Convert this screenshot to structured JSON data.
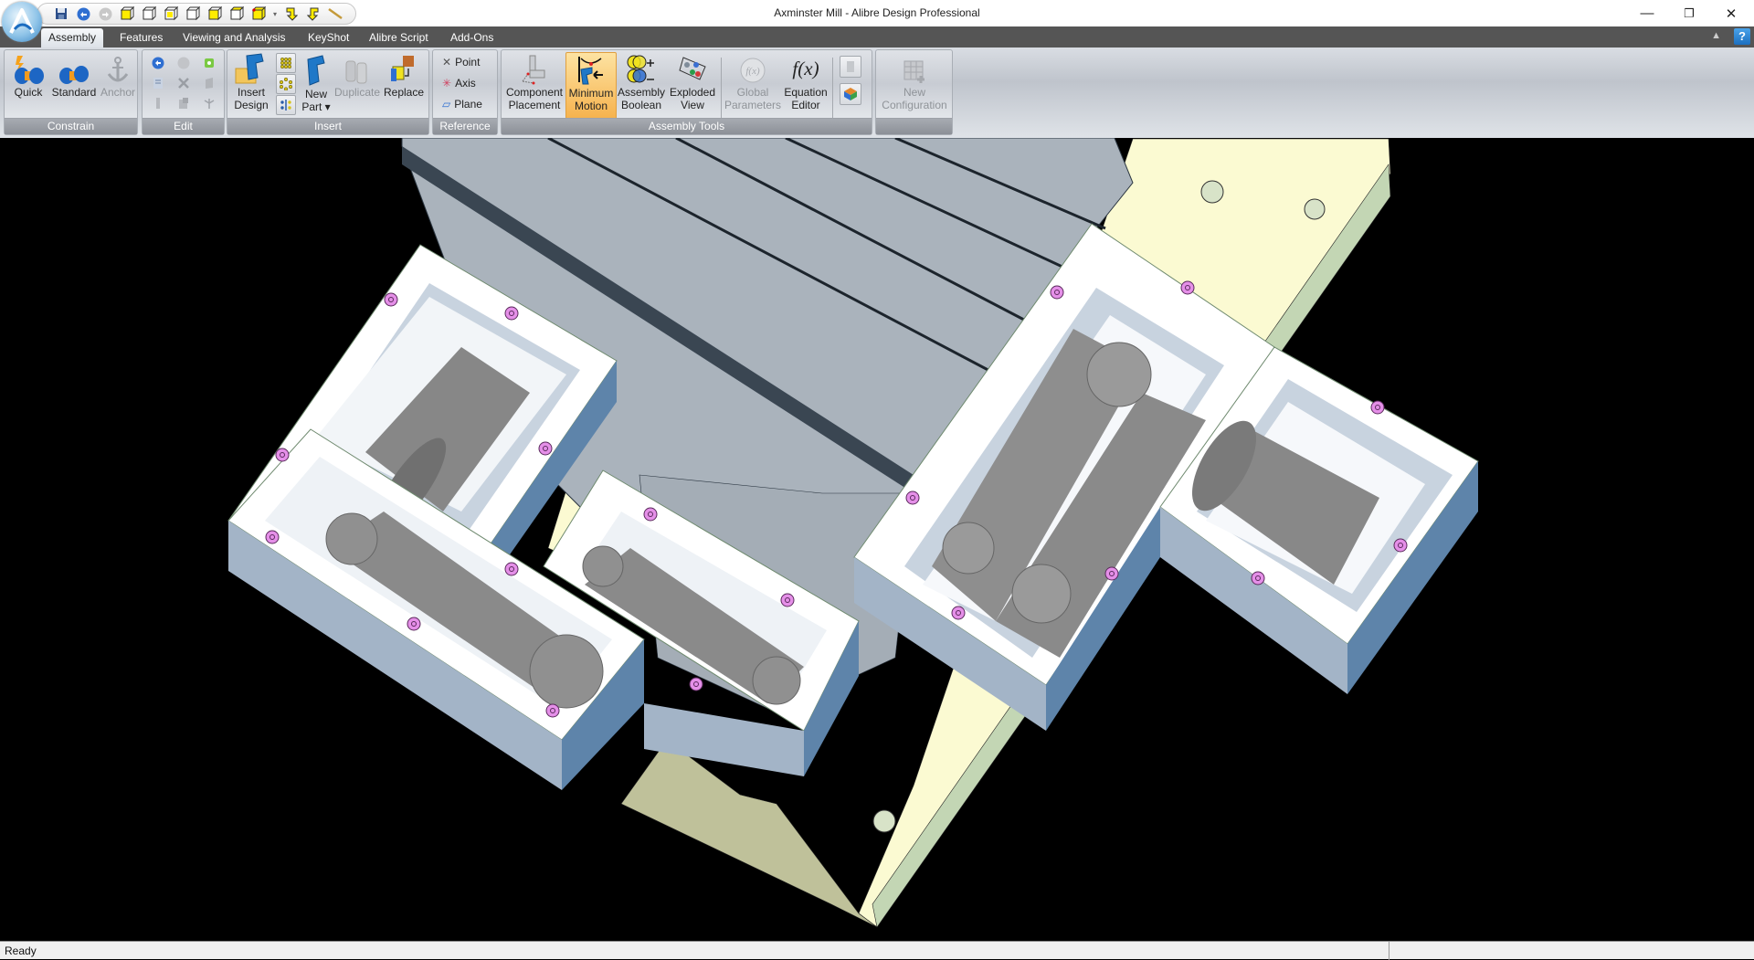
{
  "window": {
    "title": "Axminster Mill - Alibre Design Professional",
    "controls": {
      "minimize": "—",
      "restore": "❐",
      "close": "✕"
    }
  },
  "quick_access": [
    "save-icon",
    "undo-icon",
    "redo-icon",
    "view-iso-icon",
    "view-front-icon",
    "view-back-icon",
    "view-left-icon",
    "view-right-icon",
    "view-top-icon",
    "view-custom-icon",
    "view-dropdown-icon",
    "rotate-left-icon",
    "rotate-right-icon",
    "sketch-line-icon"
  ],
  "tabs": [
    {
      "label": "Assembly",
      "active": true
    },
    {
      "label": "Features",
      "active": false
    },
    {
      "label": "Viewing and Analysis",
      "active": false
    },
    {
      "label": "KeyShot",
      "active": false
    },
    {
      "label": "Alibre Script",
      "active": false
    },
    {
      "label": "Add-Ons",
      "active": false
    }
  ],
  "help": {
    "label": "?"
  },
  "collapse": {
    "label": "^"
  },
  "ribbon": {
    "constrain": {
      "label": "Constrain",
      "buttons": [
        {
          "label": "Quick",
          "enabled": true
        },
        {
          "label": "Standard",
          "enabled": true
        },
        {
          "label": "Anchor",
          "enabled": false
        }
      ]
    },
    "edit": {
      "label": "Edit"
    },
    "insert": {
      "label": "Insert",
      "insert_design": {
        "line1": "Insert",
        "line2": "Design"
      },
      "new_part": {
        "line1": "New",
        "line2": "Part ▾"
      },
      "duplicate": {
        "label": "Duplicate",
        "enabled": false
      },
      "replace": {
        "label": "Replace",
        "enabled": true
      }
    },
    "reference": {
      "label": "Reference",
      "point": "Point",
      "axis": "Axis",
      "plane": "Plane"
    },
    "assembly_tools": {
      "label": "Assembly Tools",
      "component_placement": {
        "line1": "Component",
        "line2": "Placement"
      },
      "minimum_motion": {
        "line1": "Minimum",
        "line2": "Motion",
        "active": true
      },
      "assembly_boolean": {
        "line1": "Assembly",
        "line2": "Boolean"
      },
      "exploded_view": {
        "line1": "Exploded",
        "line2": "View"
      },
      "global_parameters": {
        "line1": "Global",
        "line2": "Parameters",
        "enabled": false
      },
      "equation_editor": {
        "line1": "Equation",
        "line2": "Editor",
        "glyph": "f(x)"
      }
    },
    "configuration": {
      "new_configuration": {
        "line1": "New",
        "line2": "Configuration",
        "enabled": false
      }
    }
  },
  "viewport": {
    "model": "Axminster Mill assembly",
    "colors": {
      "background": "#000000",
      "housing_top": "#ffffff",
      "housing_side": "#9aaabe",
      "housing_dark_side": "#5e84aa",
      "table": "#aab3bc",
      "rail": "#fbfad2",
      "rail_side": "#c3d6b4",
      "motor": "#878787",
      "bolt": "#e58fe8"
    }
  },
  "status": {
    "text": "Ready"
  }
}
